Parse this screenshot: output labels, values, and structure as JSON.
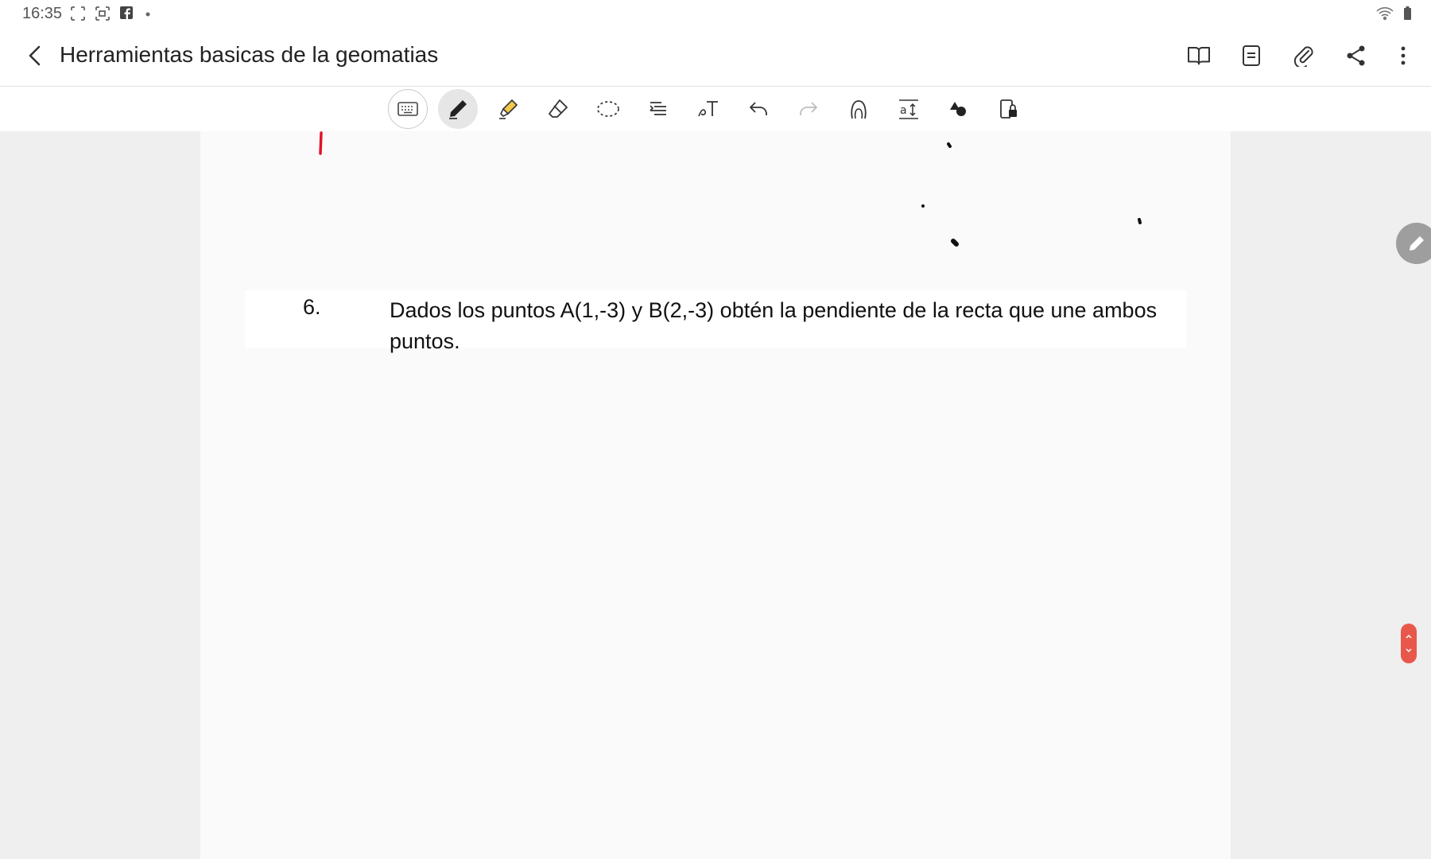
{
  "status_bar": {
    "time": "16:35",
    "left_icons": [
      "screenshot-frame-icon",
      "screen-record-icon",
      "facebook-icon",
      "dot-icon"
    ],
    "right_icons": [
      "wifi-icon",
      "battery-icon"
    ]
  },
  "app_bar": {
    "title": "Herramientas basicas de la geomatias",
    "back_icon": "back-arrow-icon",
    "actions": [
      "book-view-icon",
      "page-list-icon",
      "attachment-icon",
      "share-icon",
      "more-options-icon"
    ]
  },
  "toolbar": {
    "tools": [
      "keyboard-icon",
      "pen-icon",
      "highlighter-icon",
      "eraser-icon",
      "lasso-icon",
      "text-align-icon",
      "handwriting-to-text-icon",
      "undo-icon",
      "redo-icon",
      "shape-icon",
      "text-size-icon",
      "color-shapes-icon",
      "read-only-icon"
    ],
    "active_tool": "pen-icon"
  },
  "page": {
    "question_number": "6.",
    "question_text": "Dados los puntos A(1,-3) y B(2,-3) obtén la pendiente de la recta que une ambos puntos."
  },
  "colors": {
    "accent_red": "#e8584a",
    "ink_red": "#e0142a",
    "ink_black": "#111111"
  }
}
